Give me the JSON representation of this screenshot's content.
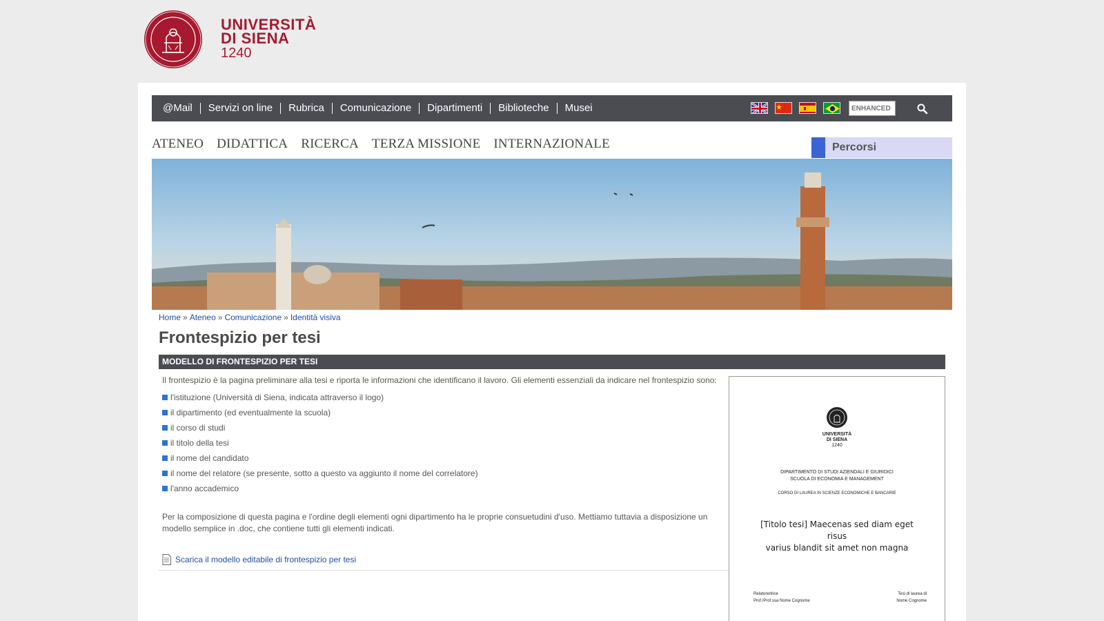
{
  "logo": {
    "line1": "UNIVERSITÀ",
    "line2": "DI SIENA",
    "year": "1240",
    "brand_color": "#a6192e"
  },
  "topnav": {
    "links": [
      "@Mail",
      "Servizi on line",
      "Rubrica",
      "Comunicazione",
      "Dipartimenti",
      "Biblioteche",
      "Musei"
    ],
    "flags": [
      "uk-flag-icon",
      "china-flag-icon",
      "spain-flag-icon",
      "brazil-flag-icon"
    ],
    "search_placeholder": "ENHANCED",
    "search_icon": "search-icon"
  },
  "mainnav": {
    "items": [
      "ATENEO",
      "DIDATTICA",
      "RICERCA",
      "TERZA MISSIONE",
      "INTERNAZIONALE"
    ]
  },
  "percorsi": {
    "label": "Percorsi",
    "accent": "#3a63d3"
  },
  "breadcrumb": {
    "items": [
      "Home",
      "Ateneo",
      "Comunicazione",
      "Identità visiva"
    ],
    "separator": "»"
  },
  "page": {
    "title": "Frontespizio per tesi",
    "section_title": "MODELLO DI FRONTESPIZIO PER TESI",
    "intro": "Il frontespizio è la pagina preliminare alla tesi e riporta le informazioni che identificano il lavoro. Gli elementi essenziali da indicare nel frontespizio sono:",
    "list": [
      "l'istituzione (Università di Siena, indicata attraverso il logo)",
      "il dipartimento (ed eventualmente la scuola)",
      "il corso di studi",
      "il titolo della tesi",
      "il nome del candidato",
      "il nome del relatore (se presente, sotto a questo va aggiunto il nome del correlatore)",
      "l'anno accademico"
    ],
    "paragraph": "Per la composizione di questa pagina e l'ordine degli elementi ogni dipartimento ha le proprie consuetudini d'uso. Mettiamo tuttavia a disposizione un modello semplice in .doc, che contiene tutti gli elementi indicati.",
    "download_label": "Scarica il modello editabile di frontespizio per tesi"
  },
  "preview": {
    "brand_line1": "UNIVERSITÀ",
    "brand_line2": "DI SIENA",
    "brand_year": "1240",
    "dept_line1": "DIPARTIMENTO DI STUDI AZIENDALI E GIURIDICI",
    "dept_line2": "SCUOLA DI ECONOMIA E MANAGEMENT",
    "course": "CORSO DI LAUREA IN SCIENZE ECONOMICHE E BANCARIE",
    "thesis_title_line1": "[Titolo tesi] Maecenas sed diam eget risus",
    "thesis_title_line2": "varius blandit sit amet non magna",
    "relatore_label": "Relatore/trice",
    "relatore_name": "Prof./Prof.ssa Nome Cognome",
    "candidate_label": "Tesi di laurea di",
    "candidate_name": "Nome Cognome"
  }
}
